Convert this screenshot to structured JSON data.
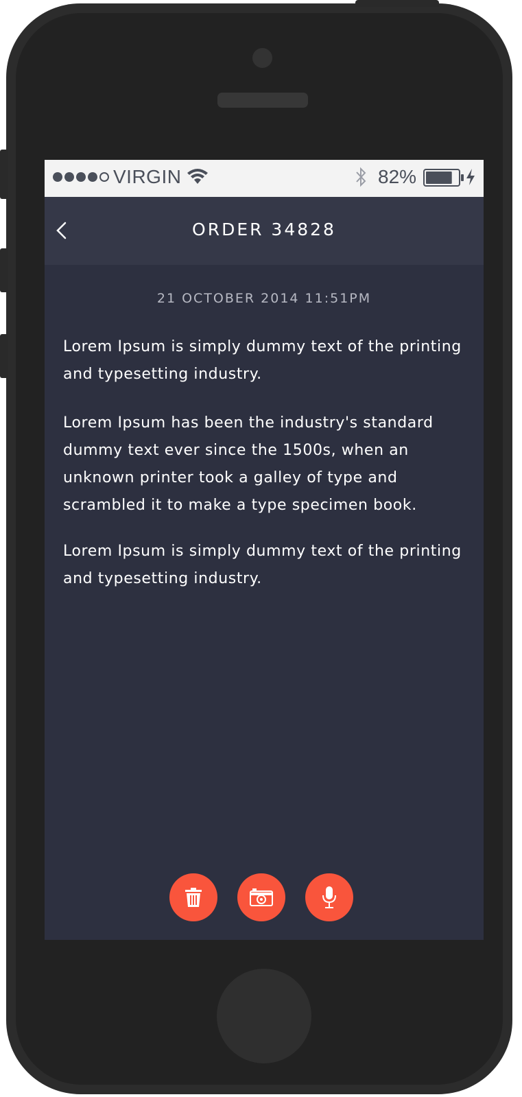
{
  "status_bar": {
    "signal_bars": 5,
    "signal_filled": 4,
    "carrier": "VIRGIN",
    "battery_percent": "82%",
    "battery_level": 0.82
  },
  "header": {
    "title": "ORDER 34828",
    "back_icon": "chevron-left-icon"
  },
  "content": {
    "timestamp": "21 OCTOBER 2014 11:51PM",
    "paragraphs": [
      "Lorem Ipsum is simply dummy text of the printing and typesetting industry.",
      "Lorem Ipsum has been the industry's standard dummy text ever since the 1500s, when an unknown printer took a galley of type and scrambled it to make a type specimen book.",
      "Lorem Ipsum is simply dummy text of the printing and typesetting industry."
    ]
  },
  "actions": [
    {
      "icon": "trash-icon"
    },
    {
      "icon": "camera-icon"
    },
    {
      "icon": "microphone-icon"
    }
  ],
  "colors": {
    "accent": "#f9553c",
    "background": "#2d3040",
    "header": "#353848",
    "status_bar": "#f3f3f3"
  }
}
